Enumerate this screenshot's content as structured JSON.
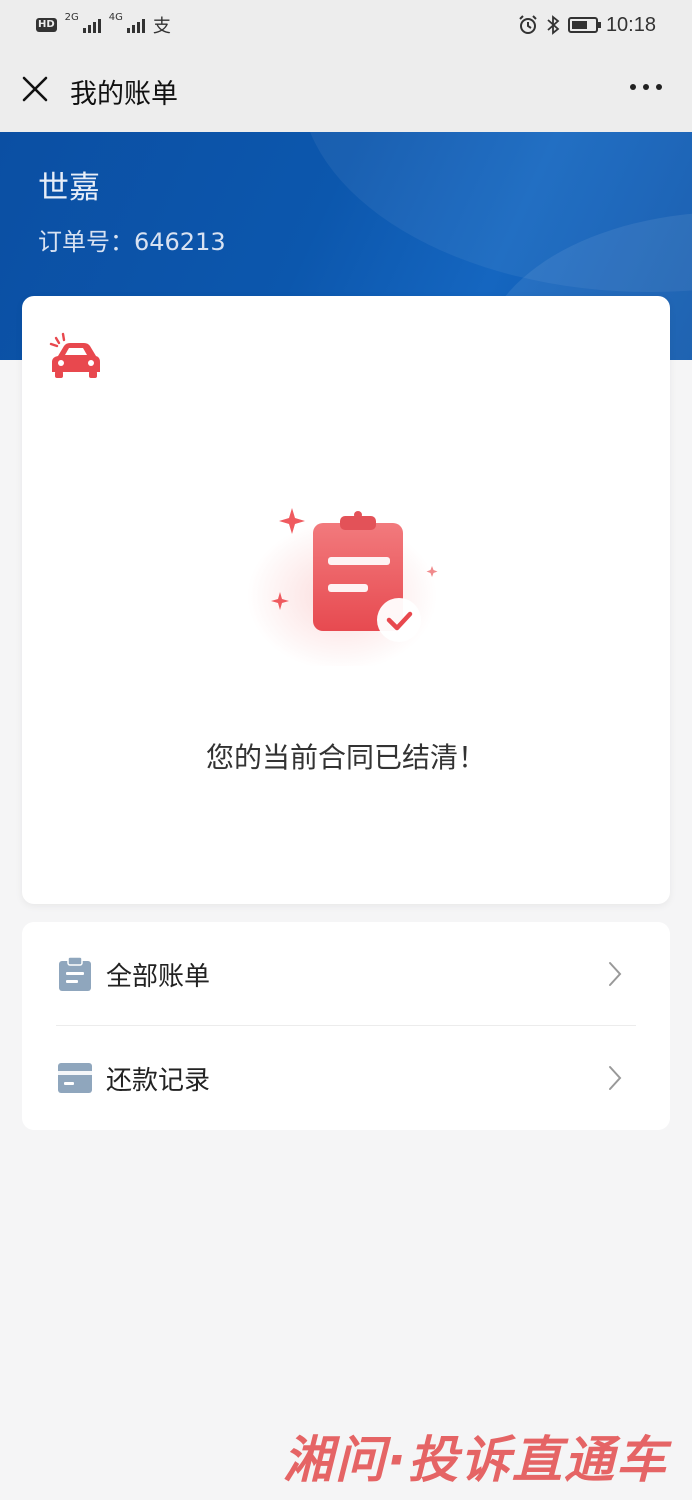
{
  "status_bar": {
    "left_badge": "HD",
    "net1": "2G",
    "net2": "4G",
    "pay_glyph": "支",
    "time": "10:18"
  },
  "nav": {
    "title": "我的账单"
  },
  "header": {
    "name": "世嘉",
    "order_label": "订单号：646213"
  },
  "main_card": {
    "message": "您的当前合同已结清！"
  },
  "menu": {
    "items": [
      {
        "label": "全部账单",
        "icon": "clipboard-icon"
      },
      {
        "label": "还款记录",
        "icon": "card-icon"
      }
    ]
  },
  "watermark": {
    "text": "湘问·投诉直通车"
  },
  "colors": {
    "header_blue": "#0c57ad",
    "accent_red": "#e8484e",
    "icon_gray_blue": "#8fa6bd"
  }
}
